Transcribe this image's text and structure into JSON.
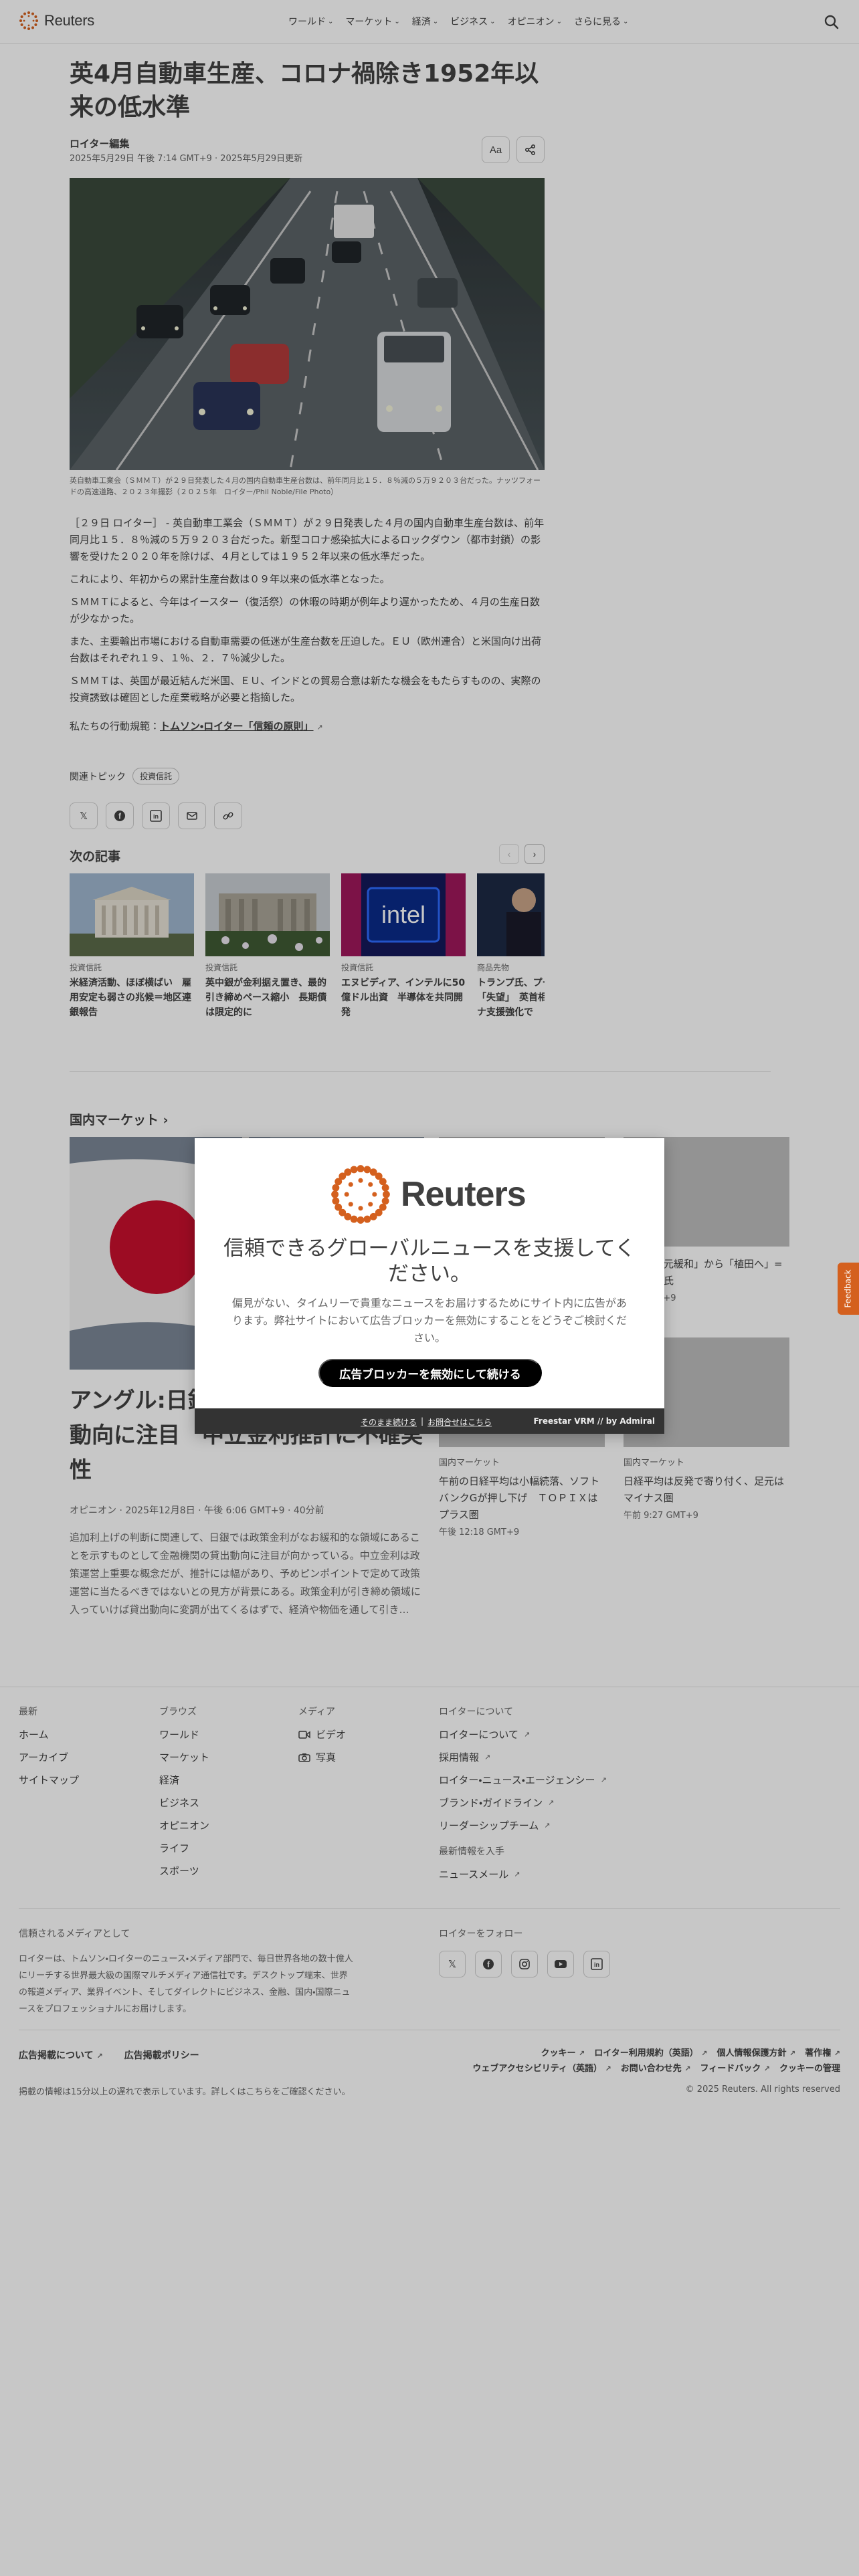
{
  "header": {
    "brand": "Reuters",
    "nav": [
      {
        "label": "ワールド"
      },
      {
        "label": "マーケット"
      },
      {
        "label": "経済"
      },
      {
        "label": "ビジネス"
      },
      {
        "label": "オピニオン"
      },
      {
        "label": "さらに見る"
      }
    ]
  },
  "article": {
    "headline": "英4月自動車生産、コロナ禍除き1952年以来の低水準",
    "byline": "ロイター編集",
    "dateline": "2025年5月29日 午後 7:14 GMT+9 · 2025年5月29日更新",
    "text_size_label": "Aa",
    "caption": "英自動車工業会（ＳＭＭＴ）が２９日発表した４月の国内自動車生産台数は、前年同月比１５．８％減の５万９２０３台だった。ナッツフォードの高速道路、２０２３年撮影（２０２５年　ロイター/Phil Noble/File Photo）",
    "paragraphs": [
      "［２９日 ロイター］ - 英自動車工業会（ＳＭＭＴ）が２９日発表した４月の国内自動車生産台数は、前年同月比１５．８％減の５万９２０３台だった。新型コロナ感染拡大によるロックダウン（都市封鎖）の影響を受けた２０２０年を除けば、４月としては１９５２年以来の低水準だった。",
      "これにより、年初からの累計生産台数は０９年以来の低水準となった。",
      "ＳＭＭＴによると、今年はイースター（復活祭）の休暇の時期が例年より遅かったため、４月の生産日数が少なかった。",
      "また、主要輸出市場における自動車需要の低迷が生産台数を圧迫した。ＥＵ（欧州連合）と米国向け出荷台数はそれぞれ１９、１％、２．７％減少した。",
      "ＳＭＭＴは、英国が最近結んだ米国、ＥＵ、インドとの貿易合意は新たな機会をもたらすものの、実際の投資誘致は確固とした産業戦略が必要と指摘した。"
    ],
    "ethics_prefix": "私たちの行動規範：",
    "ethics_link": "トムソン・ロイター「信頼の原則」",
    "topics_label": "関連トピック",
    "topic_chip": "投資信託",
    "next_heading": "次の記事",
    "next_cards": [
      {
        "kicker": "投資信託",
        "title": "米経済活動、ほぼ横ばい　雇用安定も弱さの兆候＝地区連銀報告"
      },
      {
        "kicker": "投資信託",
        "title": "英中銀が金利据え置き、最的引き締めペース縮小　長期債は限定的に"
      },
      {
        "kicker": "投資信託",
        "title": "エヌビディア、インテルに50億ドル出資　半導体を共同開発"
      },
      {
        "kicker": "商品先物",
        "title": "トランプ氏、プーチン氏に「失望」　英首相とウクライナ支援強化で"
      }
    ]
  },
  "market": {
    "heading": "国内マーケット",
    "lead_title": "アングル:日銀、利上げ判断で貸出動向に注目　中立金利推計に不確実性",
    "lead_meta": "オピニオン · 2025年12月8日 · 午後 6:06 GMT+9 · 40分前",
    "lead_desc": "追加利上げの判断に関連して、日銀では政策金利がなお緩和的な領域にあることを示すものとして金融機関の貸出動向に注目が向かっている。中立金利は政策運営上重要な概念だが、推計には幅があり、予めピンポイントで定めて政策運営に当たるべきではないとの見方が背景にある。政策金利が引き締め領域に入っていけば貸出動向に変調が出てくるはずで、経済や物価を通して引き…",
    "cards": [
      {
        "kicker": "国内マーケット",
        "title": "「超異次元緩和」から「植田へ」=門間一夫氏",
        "time": "午後 GMT+9"
      },
      {
        "kicker": "国内マーケット",
        "title": "午前の日経平均は小幅続落、ソフトバンクGが押し下げ　ＴＯＰＩＸはプラス圏",
        "time": "午後 12:18 GMT+9"
      },
      {
        "kicker": "国内マーケット",
        "title": "日経平均は反発で寄り付く、足元はマイナス圏",
        "time": "午前 9:27 GMT+9"
      }
    ]
  },
  "footer": {
    "col1": {
      "heading": "最新",
      "links": [
        "ホーム",
        "アーカイブ",
        "サイトマップ"
      ]
    },
    "col2": {
      "heading": "ブラウズ",
      "links": [
        "ワールド",
        "マーケット",
        "経済",
        "ビジネス",
        "オピニオン",
        "ライフ",
        "スポーツ"
      ]
    },
    "col3": {
      "heading": "メディア",
      "links": [
        "ビデオ",
        "写真"
      ]
    },
    "col4": {
      "heading": "ロイターについて",
      "links": [
        "ロイターについて",
        "採用情報",
        "ロイター・ニュース・エージェンシー",
        "ブランド・ガイドライン",
        "リーダーシップチーム"
      ]
    },
    "col4b": {
      "heading": "最新情報を入手",
      "links": [
        "ニュースメール"
      ]
    },
    "trusted_heading": "信頼されるメディアとして",
    "trusted_text": "ロイターは、トムソン・ロイターのニュース・メディア部門で、毎日世界各地の数十億人にリーチする世界最大級の国際マルチメディア通信社です。デスクトップ端末、世界の報道メディア、業界イベント、そしてダイレクトにビジネス、金融、国内・国際ニュースをプロフェッショナルにお届けします。",
    "follow_heading": "ロイターをフォロー",
    "legal_left": [
      "広告掲載について",
      "広告掲載ポリシー"
    ],
    "legal_right": [
      "クッキー",
      "ロイター利用規約（英語）",
      "個人情報保護方針",
      "著作権",
      "ウェブアクセシビリティ（英語）",
      "お問い合わせ先",
      "フィードバック",
      "クッキーの管理"
    ],
    "delay_note": "掲載の情報は15分以上の遅れで表示しています。詳しくはこちらをご確認ください。",
    "copyright": "© 2025 Reuters. All rights reserved"
  },
  "modal": {
    "brand": "Reuters",
    "title": "信頼できるグローバルニュースを支援してください。",
    "body": "偏見がない、タイムリーで貴重なニュースをお届けするためにサイト内に広告があります。弊社サイトにおいて広告ブロッカーを無効にすることをどうぞご検討ください。",
    "cta": "広告ブロッカーを無効にして続ける",
    "continue_link": "そのまま続ける",
    "separator": "|",
    "contact_link": "お問合せはこちら",
    "provider": "Freestar VRM // by Admiral"
  },
  "feedback": "Feedback",
  "colors": {
    "accent": "#d4601e",
    "text": "#404040",
    "muted": "#666666",
    "overlay": "rgba(0,0,0,0.22)"
  }
}
